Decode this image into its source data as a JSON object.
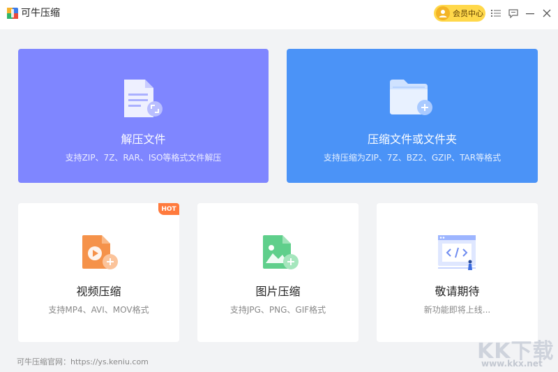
{
  "window": {
    "title": "可牛压缩",
    "vip_label": "会员中心",
    "icons": [
      "app-logo-icon",
      "user-avatar-icon",
      "menu-list-icon",
      "feedback-icon",
      "minimize-icon",
      "close-icon"
    ]
  },
  "cards": {
    "extract": {
      "title": "解压文件",
      "desc": "支持ZIP、7Z、RAR、ISO等格式文件解压",
      "icon": "document-extract-icon"
    },
    "compress": {
      "title": "压缩文件或文件夹",
      "desc": "支持压缩为ZIP、7Z、BZ2、GZIP、TAR等格式",
      "icon": "folder-compress-icon"
    },
    "video": {
      "title": "视频压缩",
      "desc": "支持MP4、AVI、MOV格式",
      "badge": "HOT",
      "icon": "video-compress-icon"
    },
    "image": {
      "title": "图片压缩",
      "desc": "支持JPG、PNG、GIF格式",
      "icon": "image-compress-icon"
    },
    "soon": {
      "title": "敬请期待",
      "desc": "新功能即将上线...",
      "icon": "code-window-icon"
    }
  },
  "footer": {
    "text": "可牛压缩官网：https://ys.keniu.com"
  },
  "watermark": {
    "logo_text": "KK下载",
    "url": "www.kkx.net"
  },
  "colors": {
    "extract_card": "#7f86ff",
    "compress_card": "#4b93f7",
    "vip": "#ffd84a",
    "hot_badge": "#ff7a3d",
    "background": "#f2f3f5"
  }
}
